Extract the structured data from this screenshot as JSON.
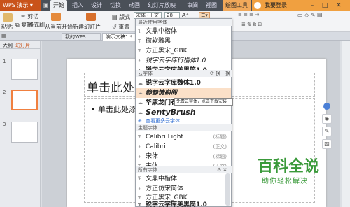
{
  "app": {
    "title": "WPS 演示"
  },
  "menu_tabs": [
    "开始",
    "插入",
    "设计",
    "切换",
    "动画",
    "幻灯片放映",
    "审阅",
    "视图",
    "绘图工具"
  ],
  "login": "我要登录",
  "ribbon": {
    "paste": "粘贴",
    "cut": "剪切",
    "copy": "复制",
    "format_painter": "格式刷",
    "from_current": "从当前开始",
    "new_slide": "新建幻灯片",
    "layout": "版式",
    "reset": "重置",
    "font_value": "宋体 (正文)",
    "size_value": "28"
  },
  "doc_tabs": {
    "mywps": "我的WPS",
    "doc": "演示文稿1 *"
  },
  "left_pane": {
    "outline": "大纲",
    "slides": "幻灯片",
    "slide_numbers": [
      "1",
      "2",
      "3"
    ]
  },
  "slide": {
    "title_placeholder": "单击此处",
    "body_placeholder": "• 单击此处添加"
  },
  "dropdown": {
    "recent_header": "最近使用字体",
    "recent": [
      "文鼎中楷体",
      "微软雅黑",
      "方正黑宋_GBK",
      "锐字云字库行楷体1.0",
      "锐字云字库美黑简1.0"
    ],
    "cloud_header": "云字体",
    "cloud_action": "换一换",
    "cloud": [
      "锐字云字库魏体1.0",
      "静静情斟阁",
      "华康龙门石",
      "SentyBrush"
    ],
    "more_cloud": "查看更多云字体",
    "theme_header": "主题字体",
    "theme": [
      {
        "name": "Calibri Light",
        "tag": "(标题)"
      },
      {
        "name": "Calibri",
        "tag": "(正文)"
      },
      {
        "name": "宋体",
        "tag": "(标题)"
      },
      {
        "name": "宋体",
        "tag": "(正文)"
      }
    ],
    "all_header": "所有字体",
    "all": [
      "文鼎中楷体",
      "方正仿宋简体",
      "方正黑宋_GBK",
      "锐字云字库美黑简1.0"
    ]
  },
  "tooltip": "免费云字体，点击下载安装",
  "watermark": {
    "title": "百科全说",
    "subtitle": "助你轻松解决"
  },
  "colors": {
    "accent_orange": "#c9531a",
    "selected_slide": "#f08040",
    "titlebar": "#4a5058"
  }
}
